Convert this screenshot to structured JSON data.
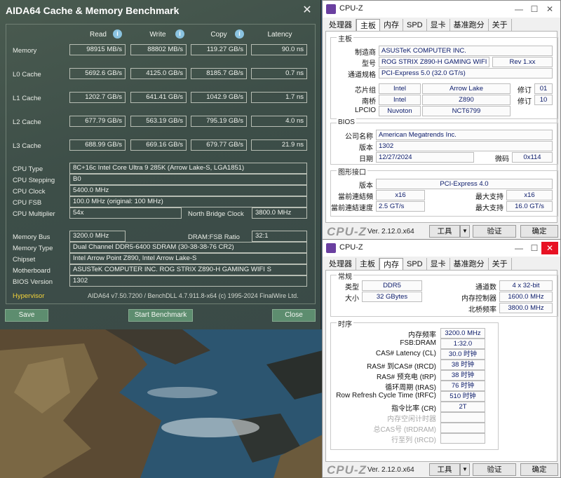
{
  "aida": {
    "title": "AIDA64 Cache & Memory Benchmark",
    "close": "✕",
    "headers": {
      "read": "Read",
      "write": "Write",
      "copy": "Copy",
      "latency": "Latency"
    },
    "info_glyph": "i",
    "rows": [
      {
        "label": "Memory",
        "read": "98915 MB/s",
        "write": "88802 MB/s",
        "copy": "119.27 GB/s",
        "latency": "90.0 ns"
      },
      {
        "label": "L0 Cache",
        "read": "5692.6 GB/s",
        "write": "4125.0 GB/s",
        "copy": "8185.7 GB/s",
        "latency": "0.7 ns"
      },
      {
        "label": "L1 Cache",
        "read": "1202.7 GB/s",
        "write": "641.41 GB/s",
        "copy": "1042.9 GB/s",
        "latency": "1.7 ns"
      },
      {
        "label": "L2 Cache",
        "read": "677.79 GB/s",
        "write": "563.19 GB/s",
        "copy": "795.19 GB/s",
        "latency": "4.0 ns"
      },
      {
        "label": "L3 Cache",
        "read": "688.99 GB/s",
        "write": "669.16 GB/s",
        "copy": "679.77 GB/s",
        "latency": "21.9 ns"
      }
    ],
    "cpu_type_label": "CPU Type",
    "cpu_type": "8C+16c Intel Core Ultra 9 285K  (Arrow Lake-S, LGA1851)",
    "cpu_stepping_label": "CPU Stepping",
    "cpu_stepping": "B0",
    "cpu_clock_label": "CPU Clock",
    "cpu_clock": "5400.0 MHz",
    "cpu_fsb_label": "CPU FSB",
    "cpu_fsb": "100.0 MHz  (original: 100 MHz)",
    "cpu_mult_label": "CPU Multiplier",
    "cpu_mult": "54x",
    "nb_clock_label": "North Bridge Clock",
    "nb_clock": "3800.0 MHz",
    "mem_bus_label": "Memory Bus",
    "mem_bus": "3200.0 MHz",
    "dram_ratio_label": "DRAM:FSB Ratio",
    "dram_ratio": "32:1",
    "mem_type_label": "Memory Type",
    "mem_type": "Dual Channel DDR5-6400 SDRAM  (30-38-38-76 CR2)",
    "chipset_label": "Chipset",
    "chipset": "Intel Arrow Point Z890, Intel Arrow Lake-S",
    "mobo_label": "Motherboard",
    "mobo": "ASUSTeK COMPUTER INC. ROG STRIX Z890-H GAMING WIFI S",
    "bios_label": "BIOS Version",
    "bios": "1302",
    "hypervisor": "Hypervisor",
    "version_text": "AIDA64 v7.50.7200 / BenchDLL 4.7.911.8-x64  (c) 1995-2024 FinalWire Ltd.",
    "save": "Save",
    "start": "Start Benchmark",
    "close_btn": "Close"
  },
  "cpuz1": {
    "title": "CPU-Z",
    "tabs": [
      "处理器",
      "主板",
      "内存",
      "SPD",
      "显卡",
      "基准跑分",
      "关于"
    ],
    "mb_legend": "主板",
    "mfr_k": "制造商",
    "mfr": "ASUSTeK COMPUTER INC.",
    "model_k": "型号",
    "model": "ROG STRIX Z890-H GAMING WIFI S",
    "rev": "Rev 1.xx",
    "bus_k": "通道规格",
    "bus": "PCI-Express 5.0 (32.0 GT/s)",
    "chipset_k": "芯片组",
    "chipset_vendor": "Intel",
    "chipset_name": "Arrow Lake",
    "rev_k": "修订",
    "chipset_rev": "01",
    "sb_k": "南桥",
    "sb_vendor": "Intel",
    "sb_name": "Z890",
    "sb_rev": "10",
    "lpcio_k": "LPCIO",
    "lpcio_vendor": "Nuvoton",
    "lpcio_name": "NCT6799",
    "bios_legend": "BIOS",
    "brand_k": "公司名称",
    "brand": "American Megatrends Inc.",
    "ver_k": "版本",
    "ver": "1302",
    "date_k": "日期",
    "date": "12/27/2024",
    "micro_k": "微码",
    "micro": "0x114",
    "gfx_legend": "图形接口",
    "gver_k": "版本",
    "gver": "PCI-Express 4.0",
    "curw_k": "當前連結頻",
    "curw": "x16",
    "maxw_k": "最大支持",
    "maxw": "x16",
    "curs_k": "當前連結速度",
    "curs": "2.5 GT/s",
    "maxs_k": "最大支持",
    "maxs": "16.0 GT/s",
    "logo": "CPU-Z",
    "version": "Ver. 2.12.0.x64",
    "tools": "工具",
    "validate": "验证",
    "ok": "确定"
  },
  "cpuz2": {
    "title": "CPU-Z",
    "tabs": [
      "处理器",
      "主板",
      "内存",
      "SPD",
      "显卡",
      "基准跑分",
      "关于"
    ],
    "gen_legend": "常规",
    "type_k": "类型",
    "type": "DDR5",
    "ch_k": "通道数",
    "ch": "4 x 32-bit",
    "size_k": "大小",
    "size": "32 GBytes",
    "mc_k": "内存控制器",
    "mc": "1600.0 MHz",
    "nb_k": "北桥频率",
    "nb": "3800.0 MHz",
    "timing_legend": "时序",
    "timings": [
      {
        "k": "内存频率",
        "v": "3200.0 MHz",
        "dim": false
      },
      {
        "k": "FSB:DRAM",
        "v": "1:32.0",
        "dim": false
      },
      {
        "k": "CAS# Latency (CL)",
        "v": "30.0 时钟",
        "dim": false
      },
      {
        "k": "RAS# 到CAS# (tRCD)",
        "v": "38 时钟",
        "dim": false
      },
      {
        "k": "RAS# 预充电 (tRP)",
        "v": "38 时钟",
        "dim": false
      },
      {
        "k": "循环周期 (tRAS)",
        "v": "76 时钟",
        "dim": false
      },
      {
        "k": "Row Refresh Cycle Time (tRFC)",
        "v": "510 时钟",
        "dim": false
      },
      {
        "k": "指令比率 (CR)",
        "v": "2T",
        "dim": false
      },
      {
        "k": "内存空闲计时器",
        "v": "",
        "dim": true
      },
      {
        "k": "总CAS号 (tRDRAM)",
        "v": "",
        "dim": true
      },
      {
        "k": "行至列 (tRCD)",
        "v": "",
        "dim": true
      }
    ],
    "logo": "CPU-Z",
    "version": "Ver. 2.12.0.x64",
    "tools": "工具",
    "validate": "验证",
    "ok": "确定"
  }
}
